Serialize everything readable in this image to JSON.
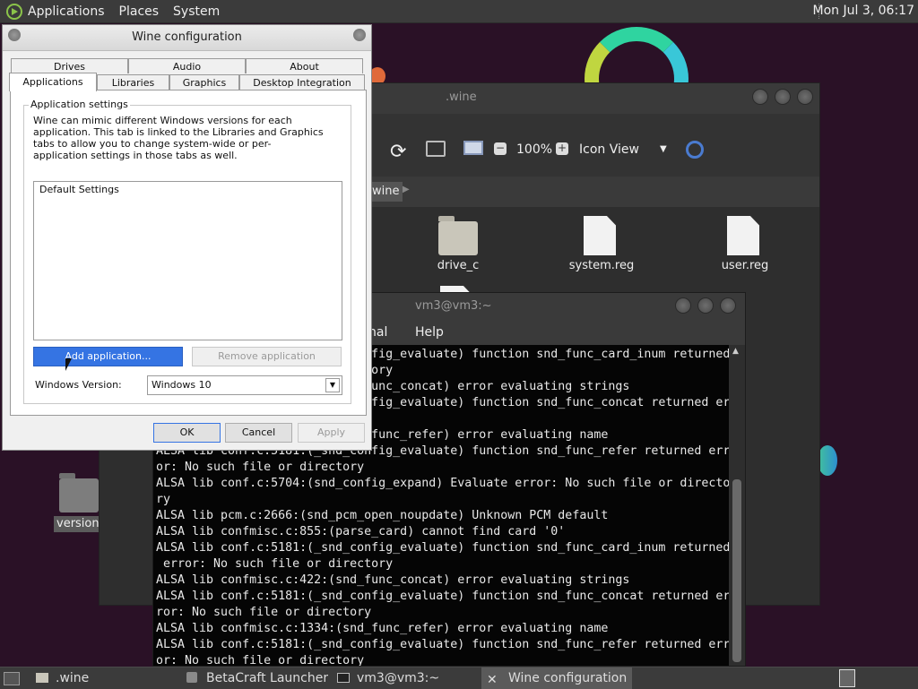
{
  "top_panel": {
    "menus": [
      "Applications",
      "Places",
      "System"
    ],
    "clock": "Mon Jul  3, 06:17"
  },
  "file_manager": {
    "title": ".wine",
    "zoom": "100%",
    "view_mode": "Icon View",
    "path_segment": "wine",
    "files": [
      {
        "name": "drive_c",
        "type": "folder"
      },
      {
        "name": "system.reg",
        "type": "file"
      },
      {
        "name": "user.reg",
        "type": "file"
      }
    ]
  },
  "desktop": {
    "folder_label": "versions"
  },
  "terminal": {
    "title": "vm3@vm3:~",
    "menu_items": [
      "nal",
      "Help"
    ],
    "lines": [
      "ALSA lib conf.c:5181:(_snd_config_evaluate) function snd_func_card_inum returned",
      " error: No such file or directory",
      "ALSA lib confmisc.c:422:(snd_func_concat) error evaluating strings",
      "ALSA lib conf.c:5181:(_snd_config_evaluate) function snd_func_concat returned er",
      "ror: No such file or directory",
      "ALSA lib confmisc.c:1334:(snd_func_refer) error evaluating name",
      "ALSA lib conf.c:5181:(_snd_config_evaluate) function snd_func_refer returned err",
      "or: No such file or directory",
      "ALSA lib conf.c:5704:(snd_config_expand) Evaluate error: No such file or directo",
      "ry",
      "ALSA lib pcm.c:2666:(snd_pcm_open_noupdate) Unknown PCM default",
      "ALSA lib confmisc.c:855:(parse_card) cannot find card '0'",
      "ALSA lib conf.c:5181:(_snd_config_evaluate) function snd_func_card_inum returned",
      " error: No such file or directory",
      "ALSA lib confmisc.c:422:(snd_func_concat) error evaluating strings",
      "ALSA lib conf.c:5181:(_snd_config_evaluate) function snd_func_concat returned er",
      "ror: No such file or directory",
      "ALSA lib confmisc.c:1334:(snd_func_refer) error evaluating name",
      "ALSA lib conf.c:5181:(_snd_config_evaluate) function snd_func_refer returned err",
      "or: No such file or directory"
    ]
  },
  "wine_dialog": {
    "title": "Wine configuration",
    "tabs_back": [
      "Drives",
      "Audio",
      "About"
    ],
    "tabs_front": [
      "Applications",
      "Libraries",
      "Graphics",
      "Desktop Integration"
    ],
    "group_title": "Application settings",
    "description": "Wine can mimic different Windows versions for each application. This tab is linked to the Libraries and Graphics tabs to allow you to change system-wide or per-application settings in those tabs as well.",
    "list_items": [
      "Default Settings"
    ],
    "add_button": "Add application...",
    "remove_button": "Remove application",
    "version_label": "Windows Version:",
    "version_value": "Windows 10",
    "ok": "OK",
    "cancel": "Cancel",
    "apply": "Apply"
  },
  "taskbar": {
    "items": [
      ".wine",
      "BetaCraft Launcher ...",
      "vm3@vm3:~",
      "Wine configuration"
    ]
  }
}
